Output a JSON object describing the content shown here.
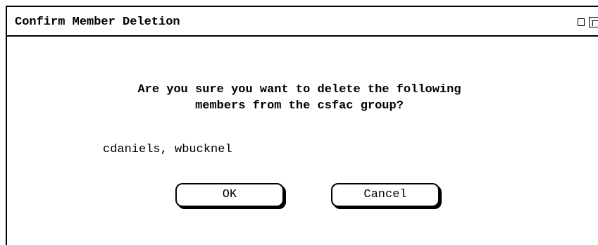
{
  "window": {
    "title": "Confirm Member Deletion"
  },
  "dialog": {
    "question_line1": "Are you sure you want to delete the following",
    "question_line2": "members from the csfac group?",
    "members": "cdaniels, wbucknel"
  },
  "buttons": {
    "ok_label": "OK",
    "cancel_label": "Cancel"
  },
  "icons": {
    "minimize": "minimize-box-icon",
    "maximize": "maximize-box-icon"
  }
}
